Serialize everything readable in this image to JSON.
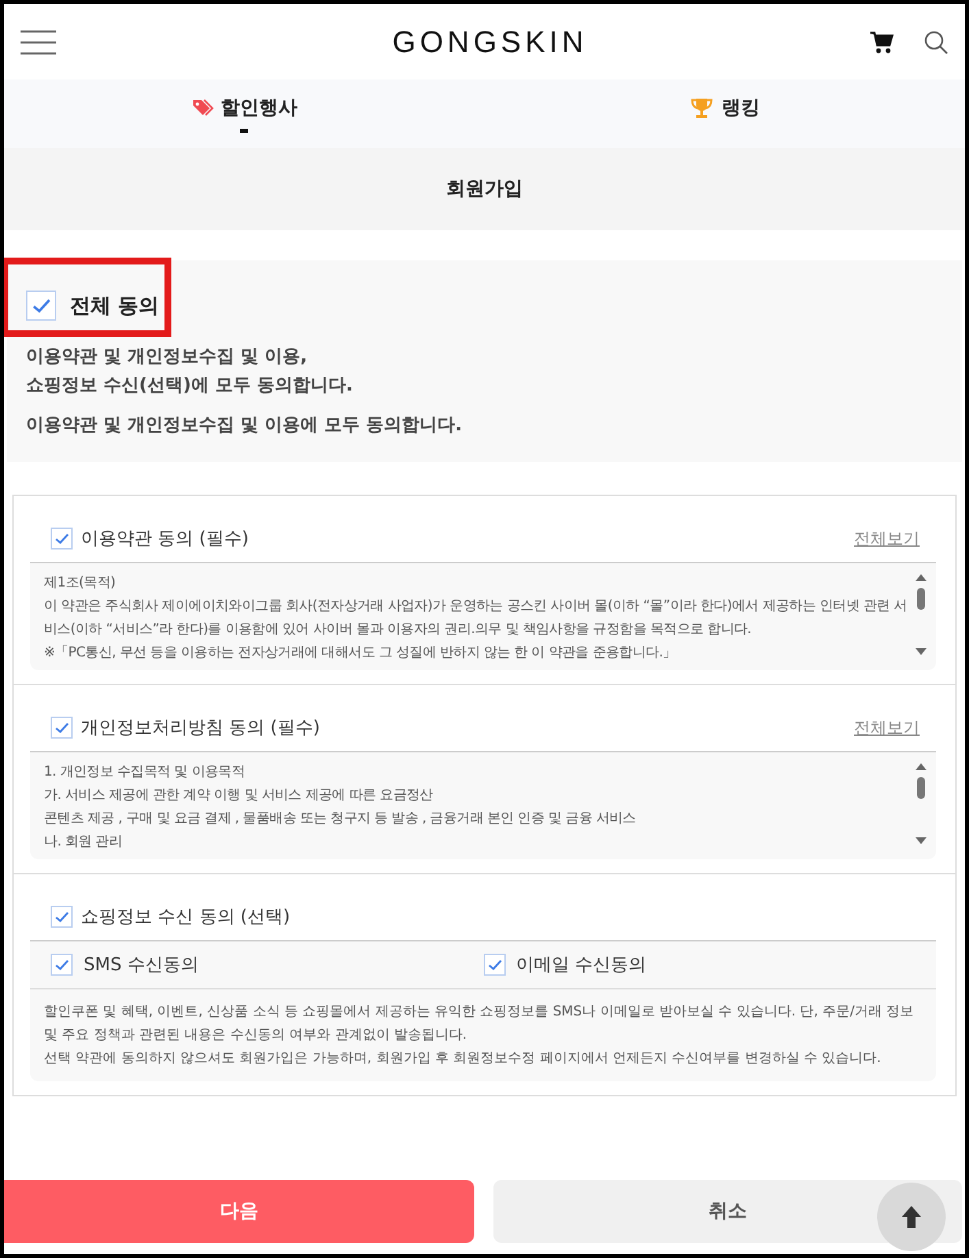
{
  "header": {
    "logo": "GONGSKIN"
  },
  "tabs": [
    {
      "label": "할인행사",
      "selected": true
    },
    {
      "label": "랭킹",
      "selected": false
    }
  ],
  "page_title": "회원가입",
  "agree_all": {
    "label": "전체 동의",
    "checked": true,
    "highlighted": true,
    "lines": [
      "이용약관 및 개인정보수집 및 이용,",
      "쇼핑정보 수신(선택)에 모두 동의합니다."
    ],
    "note": "이용약관 및 개인정보수집 및 이용에 모두 동의합니다."
  },
  "sections": [
    {
      "kind": "scroll",
      "label": "이용약관 동의 (필수)",
      "checked": true,
      "link": "전체보기",
      "lines": [
        "제1조(목적)",
        "이 약관은 주식회사 제이에이치와이그룹 회사(전자상거래 사업자)가 운영하는 공스킨 사이버 몰(이하 “몰”이라 한다)에서 제공하는 인터넷 관련 서비스(이하 “서비스”라 한다)를 이용함에 있어 사이버 몰과 이용자의 권리.의무 및 책임사항을 규정함을 목적으로 합니다.",
        "※「PC통신, 무선 등을 이용하는 전자상거래에 대해서도 그 성질에 반하지 않는 한 이 약관을 준용합니다.」"
      ]
    },
    {
      "kind": "scroll",
      "label": "개인정보처리방침 동의 (필수)",
      "checked": true,
      "link": "전체보기",
      "lines": [
        "1. 개인정보 수집목적 및 이용목적",
        "가. 서비스 제공에 관한 계약 이행 및 서비스 제공에 따른 요금정산",
        "콘텐츠 제공 , 구매 및 요금 결제 , 물품배송 또는 청구지 등 발송 , 금융거래 본인 인증 및 금융 서비스",
        "나. 회원 관리"
      ]
    },
    {
      "kind": "options",
      "label": "쇼핑정보 수신 동의 (선택)",
      "checked": true,
      "options": [
        {
          "label": "SMS 수신동의",
          "checked": true
        },
        {
          "label": "이메일 수신동의",
          "checked": true
        }
      ],
      "lines": [
        "할인쿠폰 및 혜택, 이벤트, 신상품 소식 등 쇼핑몰에서 제공하는 유익한 쇼핑정보를 SMS나 이메일로 받아보실 수 있습니다. 단, 주문/거래 정보 및 주요 정책과 관련된 내용은 수신동의 여부와 관계없이 발송됩니다.",
        "선택 약관에 동의하지 않으셔도 회원가입은 가능하며, 회원가입 후 회원정보수정 페이지에서 언제든지 수신여부를 변경하실 수 있습니다."
      ]
    }
  ],
  "buttons": [
    {
      "label": "다음",
      "kind": "primary"
    },
    {
      "label": "취소",
      "kind": "secondary"
    }
  ]
}
